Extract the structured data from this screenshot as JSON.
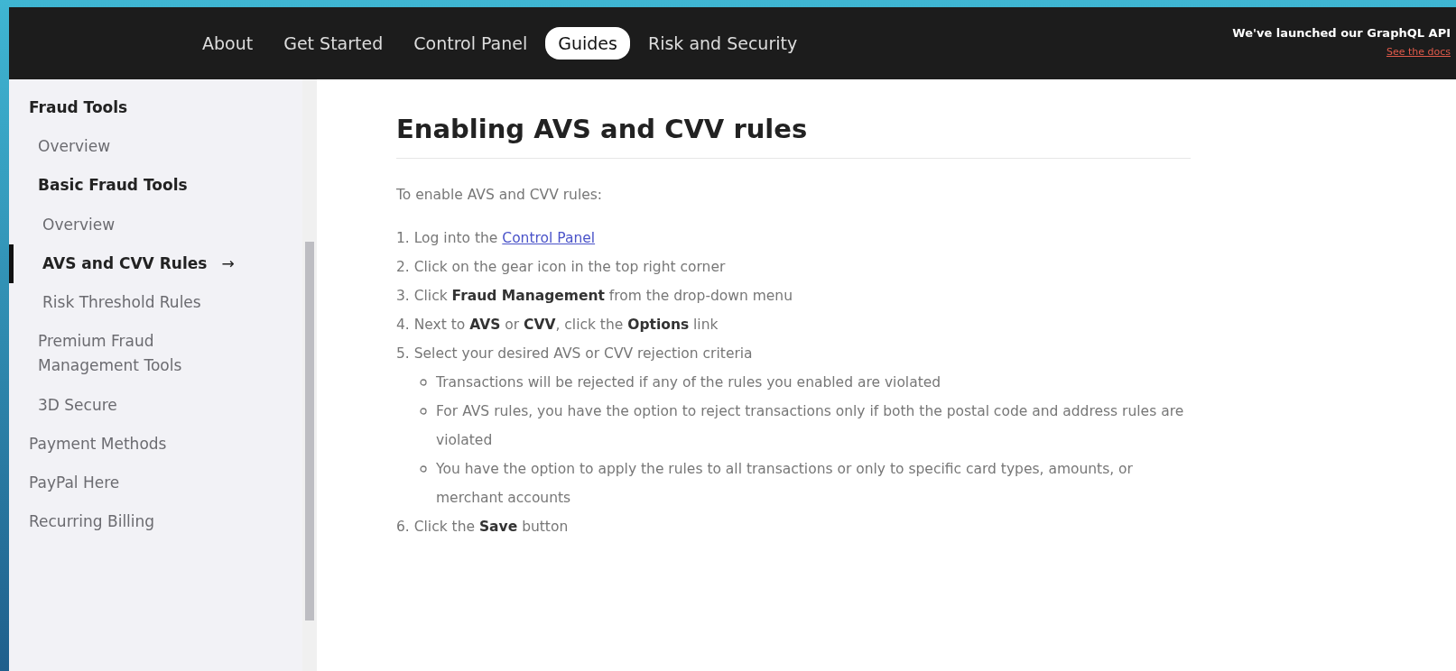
{
  "nav": {
    "items": [
      {
        "label": "About",
        "selected": false
      },
      {
        "label": "Get Started",
        "selected": false
      },
      {
        "label": "Control Panel",
        "selected": false
      },
      {
        "label": "Guides",
        "selected": true
      },
      {
        "label": "Risk and Security",
        "selected": false
      }
    ],
    "notice": {
      "title": "We've launched our GraphQL API",
      "link": "See the docs"
    }
  },
  "sidebar": {
    "items": [
      {
        "label": "Fraud Tools",
        "expanded": true,
        "children": [
          {
            "label": "Overview",
            "selected": false
          },
          {
            "label": "Basic Fraud Tools",
            "expanded": true,
            "children": [
              {
                "label": "Overview",
                "selected": false
              },
              {
                "label": "AVS and CVV Rules",
                "selected": true,
                "arrow": "→"
              },
              {
                "label": "Risk Threshold Rules",
                "selected": false
              }
            ]
          },
          {
            "label": "Premium Fraud Management Tools",
            "selected": false
          },
          {
            "label": "3D Secure",
            "selected": false
          }
        ]
      },
      {
        "label": "Payment Methods",
        "expanded": false
      },
      {
        "label": "PayPal Here",
        "expanded": false
      },
      {
        "label": "Recurring Billing",
        "expanded": false
      }
    ]
  },
  "article": {
    "title": "Enabling AVS and CVV rules",
    "intro": "To enable AVS and CVV rules:",
    "steps": [
      {
        "text": "1. Log into the ",
        "link": "Control Panel"
      },
      {
        "text": "2. Click on the gear icon in the top right corner"
      },
      {
        "text": "3. Click **Fraud Management** from the drop-down menu"
      },
      {
        "text": "4. Next to **AVS** or **CVV**, click the **Options** link"
      },
      {
        "text": "5. Select your desired AVS or CVV rejection criteria",
        "children": [
          {
            "text": "Transactions will be rejected if any of the rules you enabled are violated"
          },
          {
            "text": "For AVS rules, you have the option to reject transactions only if both the postal code and address rules are violated"
          },
          {
            "text": "You have the option to apply the rules to all transactions or only to specific card types, amounts, or merchant accounts"
          }
        ]
      },
      {
        "text": "6. Click the **Save** button"
      }
    ]
  }
}
